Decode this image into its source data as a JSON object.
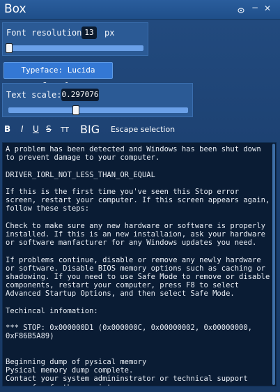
{
  "window": {
    "title": "Box",
    "icons": [
      "eye-icon",
      "minimize-icon",
      "close-icon"
    ]
  },
  "font_resolution": {
    "label": "Font resolution:",
    "value": "13",
    "unit": "px",
    "slider_fraction": 0.0
  },
  "typeface_button": {
    "label": "Typeface: Lucida Console"
  },
  "text_scale": {
    "label": "Text scale:",
    "value": "0.297076",
    "slider_fraction": 0.37
  },
  "format_toolbar": {
    "bold": "B",
    "italic": "I",
    "underline": "U",
    "strike": "S",
    "small_caps": "TT",
    "big": "BIG",
    "escape": "Escape selection"
  },
  "content": {
    "text": "A problem has been detected and Windows has been shut down to prevent damage to your computer.\n\nDRIVER_IORL_NOT_LESS_THAN_OR_EQUAL\n\nIf this is the first time you've seen this Stop error screen, restart your computer. If this screen appears again, follow these steps:\n\nCheck to make sure any new hardware or software is properly installed. If this is an new installaion, ask your hardware or software manfacturer for any Windows updates you need.\n\nIf problems continue, disable or remove any newly hardware or software. Disable BIOS memory options such as caching or shadowing. If you need to use Safe Mode to remove or disable components, restart your computer, press F8 to select Advanced Startup Options, and then select Safe Mode.\n\nTechincal infomation:\n\n*** STOP: 0x000000D1 (0x000000C, 0x00000002, 0x00000000, 0xF86B5A89)\n\n\nBeginning dump of pysical memory\nPysical memory dump complete.\nContact your system admininstrator or technical support group for further assistance."
  }
}
